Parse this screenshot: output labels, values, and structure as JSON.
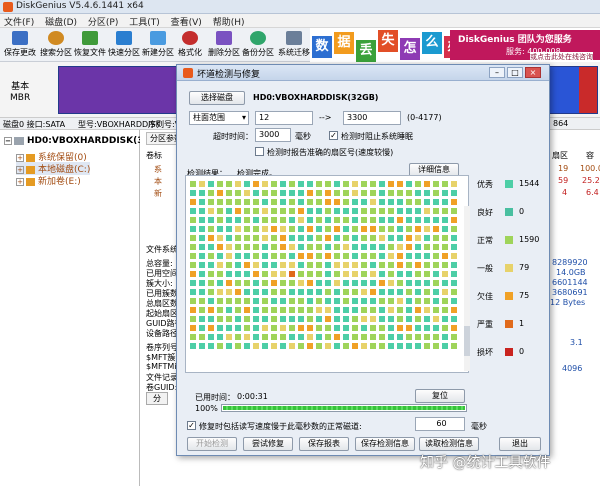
{
  "app": {
    "title": "DiskGenius V5.4.6.1441 x64"
  },
  "menu": [
    "文件(F)",
    "磁盘(D)",
    "分区(P)",
    "工具(T)",
    "查看(V)",
    "帮助(H)"
  ],
  "toolbar": [
    "保存更改",
    "搜索分区",
    "恢复文件",
    "快速分区",
    "新建分区",
    "格式化",
    "删除分区",
    "备份分区",
    "系统迁移"
  ],
  "banner": {
    "chars": [
      "数",
      "据",
      "丢",
      "失",
      "怎",
      "么",
      "办"
    ],
    "brand": "DiskGenius 团队为您服务",
    "phone": "服务: 400-008",
    "sub": "或点击此处在线咨询"
  },
  "diskmap": {
    "label_line1": "基本",
    "label_line2": "MBR"
  },
  "infobar": {
    "disk": "磁盘0 接口:SATA",
    "model": "型号:VBOXHARDDISK",
    "serial": "序列号:VB",
    "tail": "864"
  },
  "tree": {
    "disk": "HD0:VBOXHARDDISK(32GB)",
    "items": [
      "系统保留(0)",
      "本地磁盘(C:)",
      "新加卷(E:)"
    ]
  },
  "rightpane": {
    "tabs": "分区参数",
    "volume_label": "卷标",
    "sector_header": "扇区",
    "col_extra": "容",
    "rows": [
      {
        "name": "系",
        "c1": "19",
        "c2": "100.0"
      },
      {
        "name": "本",
        "c1": "59",
        "c2": "25.2"
      },
      {
        "name": "新",
        "c1": "4",
        "c2": "6.4"
      }
    ],
    "fs_label": "文件系统",
    "props": [
      "总容量:",
      "已用空间",
      "簇大小:",
      "已用簇数",
      "总扇区数",
      "起始扇区",
      "GUID路径",
      "设备路径"
    ],
    "vals": [
      "8289920",
      "14.0GB",
      "6601144",
      "3680691",
      "12 Bytes"
    ],
    "props2": [
      "卷序列号",
      "$MFT簇号",
      "$MFTMir",
      "文件记录",
      "卷GUID:"
    ],
    "vals2": [
      "3.1",
      "4096"
    ],
    "btn": "分"
  },
  "dialog": {
    "title": "坏道检测与修复",
    "select_disk": "选择磁盘",
    "disk_name": "HD0:VBOXHARDDISK(32GB)",
    "range_mode": "柱面范围",
    "range_from": "12",
    "arrow": "-->",
    "range_to": "3300",
    "range_hint": "(0-4177)",
    "timeout_label": "超时时间：",
    "timeout_value": "3000",
    "timeout_unit": "毫秒",
    "cb_block_sleep": "检测时阻止系统睡眠",
    "cb_report": "检测时报告准确的扇区号(速度较慢)",
    "result_label": "检测结果：",
    "result_status": "检测完成。",
    "details": "详细信息",
    "legend": [
      {
        "label": "优秀",
        "count": "1544",
        "color": "#4dcea6"
      },
      {
        "label": "良好",
        "count": "0",
        "color": "#49bfa0"
      },
      {
        "label": "正常",
        "count": "1590",
        "color": "#9fd45a"
      },
      {
        "label": "一般",
        "count": "79",
        "color": "#e7d26a"
      },
      {
        "label": "欠佳",
        "count": "75",
        "color": "#f0a126"
      },
      {
        "label": "严重",
        "count": "1",
        "color": "#e06a1b"
      },
      {
        "label": "损坏",
        "count": "0",
        "color": "#c9231f"
      }
    ],
    "elapsed_label": "已用时间：",
    "elapsed_value": "0:00:31",
    "reset": "复位",
    "progress": 100,
    "progress_text": "100%",
    "cb_repair": "修复时包括读写速度慢于此毫秒数的正常磁道:",
    "repair_ms": "60",
    "repair_unit": "毫秒",
    "buttons": [
      "开始检测",
      "尝试修复",
      "保存报表",
      "保存检测信息",
      "读取检测信息",
      "退出"
    ]
  },
  "watermark": "知乎 @统计工具软件"
}
